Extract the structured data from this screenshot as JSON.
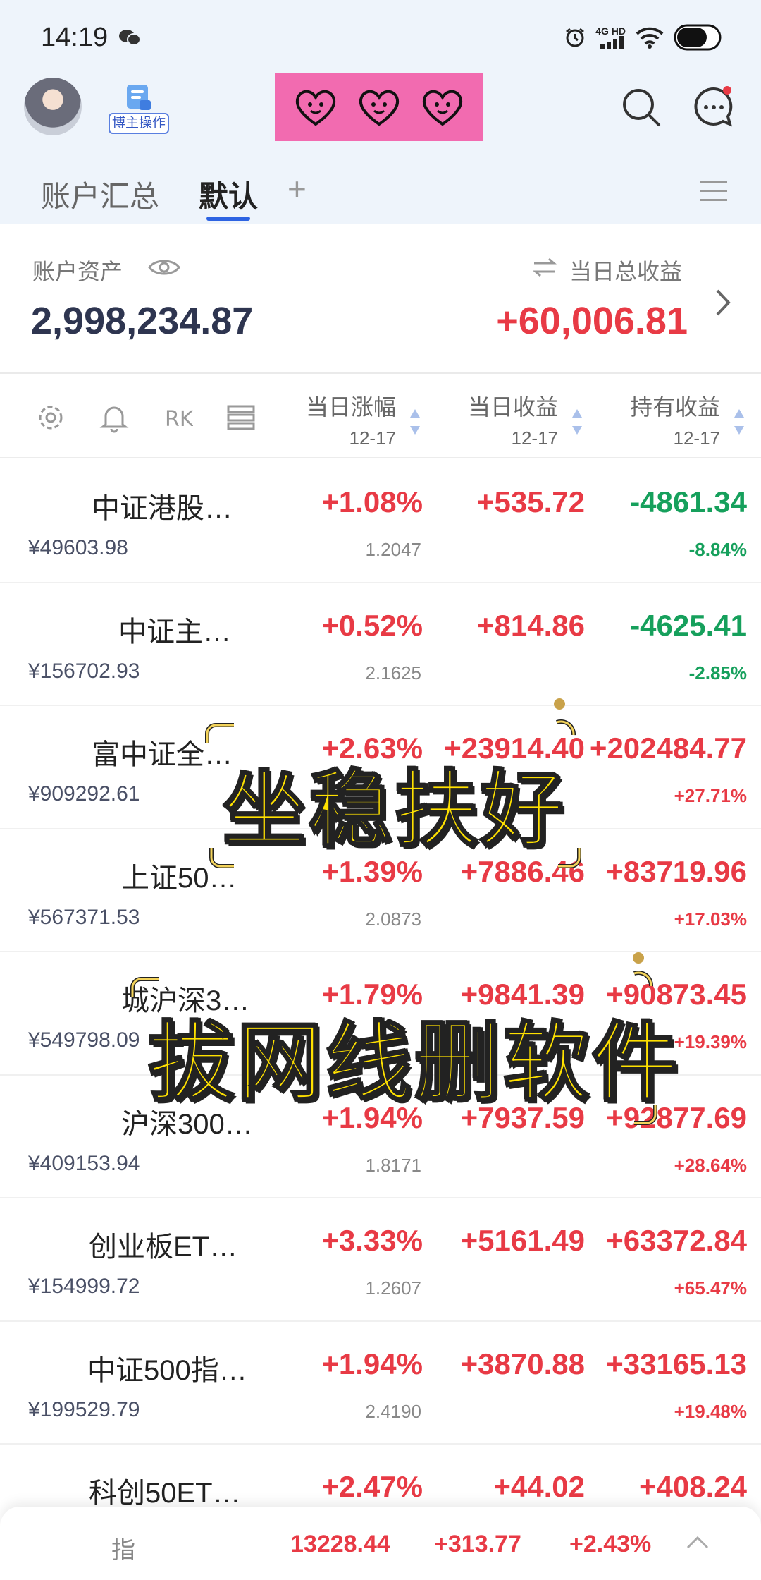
{
  "status_bar": {
    "time": "14:19",
    "network": "4G HD"
  },
  "header": {
    "blogger_label": "博主操作"
  },
  "tabs": {
    "summary": "账户汇总",
    "default": "默认",
    "add": "+"
  },
  "summary": {
    "asset_label": "账户资产",
    "asset_value": "2,998,234.87",
    "profit_label": "当日总收益",
    "profit_value": "+60,006.81"
  },
  "table_header": {
    "col1_title": "当日涨幅",
    "col1_date": "12-17",
    "col2_title": "当日收益",
    "col2_date": "12-17",
    "col3_title": "持有收益",
    "col3_date": "12-17"
  },
  "rows": [
    {
      "name": "中证港股…",
      "market_value": "¥49603.98",
      "change": "+1.08%",
      "nav": "1.2047",
      "day_profit": "+535.72",
      "hold_profit": "-4861.34",
      "hold_pct": "-8.84%"
    },
    {
      "name": "中证主…",
      "market_value": "¥156702.93",
      "change": "+0.52%",
      "nav": "2.1625",
      "day_profit": "+814.86",
      "hold_profit": "-4625.41",
      "hold_pct": "-2.85%"
    },
    {
      "name": "富中证全…",
      "market_value": "¥909292.61",
      "change": "+2.63%",
      "nav": "",
      "day_profit": "+23914.40",
      "hold_profit": "+202484.77",
      "hold_pct": "+27.71%"
    },
    {
      "name": "上证50…",
      "market_value": "¥567371.53",
      "change": "+1.39%",
      "nav": "2.0873",
      "day_profit": "+7886.46",
      "hold_profit": "+83719.96",
      "hold_pct": "+17.03%"
    },
    {
      "name": "城沪深3…",
      "market_value": "¥549798.09",
      "change": "+1.79%",
      "nav": "",
      "day_profit": "+9841.39",
      "hold_profit": "+90873.45",
      "hold_pct": "+19.39%"
    },
    {
      "name": "沪深300…",
      "market_value": "¥409153.94",
      "change": "+1.94%",
      "nav": "1.8171",
      "day_profit": "+7937.59",
      "hold_profit": "+92877.69",
      "hold_pct": "+28.64%"
    },
    {
      "name": "创业板ET…",
      "market_value": "¥154999.72",
      "change": "+3.33%",
      "nav": "1.2607",
      "day_profit": "+5161.49",
      "hold_profit": "+63372.84",
      "hold_pct": "+65.47%"
    },
    {
      "name": "中证500指…",
      "market_value": "¥199529.79",
      "change": "+1.94%",
      "nav": "2.4190",
      "day_profit": "+3870.88",
      "hold_profit": "+33165.13",
      "hold_pct": "+19.48%"
    },
    {
      "name": "科创50ET…",
      "market_value": "",
      "change": "+2.47%",
      "nav": "",
      "day_profit": "+44.02",
      "hold_profit": "+408.24",
      "hold_pct": ""
    }
  ],
  "overlay": {
    "line1": "坐稳扶好",
    "line2": "拔网线删软件"
  },
  "bottom_bar": {
    "name": "指",
    "index": "13228.44",
    "change": "+313.77",
    "pct": "+2.43%"
  },
  "colors": {
    "up": "#e83a45",
    "down": "#16a05c",
    "accent": "#2d63e2",
    "sticker_bg": "#f26bb0"
  }
}
